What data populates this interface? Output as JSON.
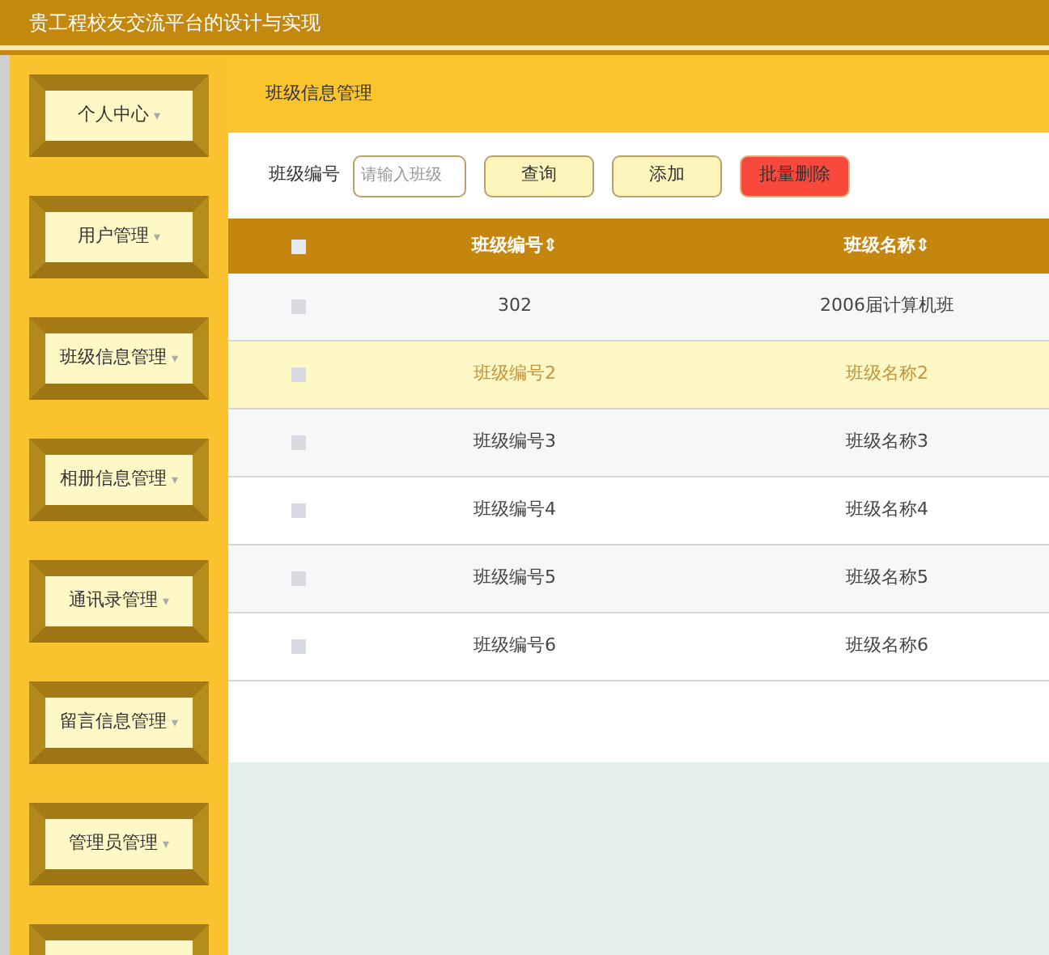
{
  "header": {
    "title": "贵工程校友交流平台的设计与实现"
  },
  "sidebar": {
    "items": [
      {
        "label": "个人中心",
        "caret": "▾"
      },
      {
        "label": "用户管理",
        "caret": "▾"
      },
      {
        "label": "班级信息管理",
        "caret": "▾"
      },
      {
        "label": "相册信息管理",
        "caret": "▾"
      },
      {
        "label": "通讯录管理",
        "caret": "▾"
      },
      {
        "label": "留言信息管理",
        "caret": "▾"
      },
      {
        "label": "管理员管理",
        "caret": "▾"
      }
    ]
  },
  "page_title": "班级信息管理",
  "search": {
    "label": "班级编号",
    "placeholder": "请输入班级"
  },
  "buttons": [
    {
      "label": "查询",
      "kind": "normal"
    },
    {
      "label": "添加",
      "kind": "normal"
    },
    {
      "label": "批量删除",
      "kind": "danger"
    }
  ],
  "table": {
    "columns": [
      "班级编号⇕",
      "班级名称⇕"
    ],
    "header_checked": false,
    "rows": [
      {
        "cells": [
          "302",
          "2006届计算机班"
        ],
        "checked": false,
        "highlighted": false
      },
      {
        "cells": [
          "班级编号2",
          "班级名称2"
        ],
        "checked": false,
        "highlighted": true
      },
      {
        "cells": [
          "班级编号3",
          "班级名称3"
        ],
        "checked": false,
        "highlighted": false
      },
      {
        "cells": [
          "班级编号4",
          "班级名称4"
        ],
        "checked": false,
        "highlighted": false
      },
      {
        "cells": [
          "班级编号5",
          "班级名称5"
        ],
        "checked": false,
        "highlighted": false
      },
      {
        "cells": [
          "班级编号6",
          "班级名称6"
        ],
        "checked": false,
        "highlighted": false
      }
    ]
  }
}
